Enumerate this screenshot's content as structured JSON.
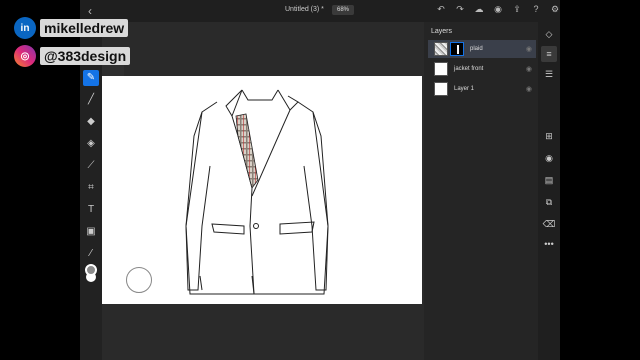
{
  "overlay": {
    "linkedin_handle": "mikelledrew",
    "instagram_handle": "@383design",
    "linkedin_icon_text": "in"
  },
  "header": {
    "doc_title": "Untitled (3) *",
    "zoom": "68%"
  },
  "brush": {
    "size": "30"
  },
  "layers": {
    "title": "Layers",
    "items": [
      {
        "name": "plaid",
        "selected": true
      },
      {
        "name": "jacket front",
        "selected": false
      },
      {
        "name": "Layer 1",
        "selected": false
      }
    ]
  },
  "colors": {
    "accent": "#1473e6",
    "panel": "#252525",
    "canvas": "#ffffff",
    "foreground_color": "#8a8a8a",
    "background_color": "#ffffff"
  },
  "icons": {
    "top": [
      "undo-icon",
      "redo-icon",
      "cloud-icon",
      "share-user-icon",
      "export-icon",
      "help-icon",
      "settings-icon"
    ],
    "tools": [
      "select-icon",
      "brush-icon",
      "eraser-icon",
      "fill-icon",
      "smudge-icon",
      "crop-icon",
      "text-icon",
      "image-icon",
      "eyedropper-icon"
    ],
    "rail": [
      "layers-icon",
      "layer-properties-icon",
      "adjustments-icon",
      "add-layer-icon",
      "visibility-icon",
      "mask-icon",
      "clip-icon",
      "delete-icon",
      "more-icon"
    ]
  }
}
